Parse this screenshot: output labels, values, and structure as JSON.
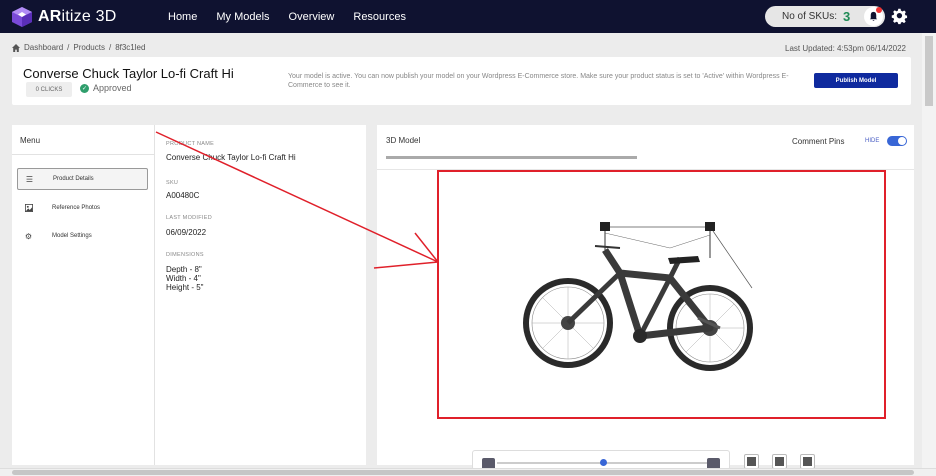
{
  "app": {
    "logo_bold": "AR",
    "logo_rest": "itize 3D",
    "nav": [
      "Home",
      "My Models",
      "Overview",
      "Resources"
    ],
    "sku_label": "No of SKUs:",
    "sku_count": "3"
  },
  "breadcrumb": {
    "items": [
      "Dashboard",
      "/",
      "Products",
      "/",
      "8f3c1led"
    ],
    "last_updated": "Last Updated: 4:53pm 06/14/2022"
  },
  "header": {
    "title": "Converse Chuck Taylor Lo-fi Craft Hi",
    "clicks": "0 CLICKS",
    "status": "Approved",
    "message": "Your model is active. You can now publish your model on your Wordpress E-Commerce store. Make sure your product status is set to 'Active' within Wordpress E-Commerce to see it.",
    "publish_label": "Publish Model"
  },
  "menu": {
    "title": "Menu",
    "items": [
      {
        "label": "Product Details",
        "icon": "list-icon",
        "active": true
      },
      {
        "label": "Reference Photos",
        "icon": "photo-icon",
        "active": false
      },
      {
        "label": "Model Settings",
        "icon": "settings-icon",
        "active": false
      }
    ]
  },
  "details": {
    "name_label": "PRODUCT NAME",
    "name_value": "Converse Chuck Taylor Lo-fi Craft Hi",
    "sku_label": "SKU",
    "sku_value": "A00480C",
    "modified_label": "LAST MODIFIED",
    "modified_value": "06/09/2022",
    "dims_label": "DIMENSIONS",
    "depth": "Depth - 8\"",
    "width": "Width - 4\"",
    "height": "Height - 5\""
  },
  "viewer": {
    "title": "3D Model",
    "comment_pins": "Comment Pins",
    "hide_label": "HIDE",
    "toggle_on": true
  },
  "colors": {
    "nav_bg": "#0f1230",
    "accent": "#0f2a9e",
    "approved": "#2f9e6c",
    "annotation": "#e0202a"
  }
}
